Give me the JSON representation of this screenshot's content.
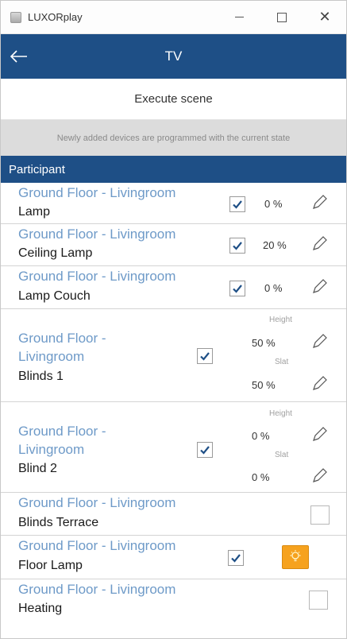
{
  "window": {
    "title": "LUXORplay",
    "minimize_icon": "minimize-icon",
    "maximize_icon": "maximize-icon",
    "close_icon": "close-icon",
    "close_glyph": "✕"
  },
  "header": {
    "title": "TV",
    "back_icon": "arrow-left-icon"
  },
  "execute_label": "Execute scene",
  "notice": "Newly added devices are programmed with the current state",
  "section_title": "Participant",
  "colors": {
    "accent": "#1e4f86",
    "location_text": "#6e9ac8",
    "bulb": "#f6a21e"
  },
  "rows": [
    {
      "location": "Ground Floor - Livingroom",
      "device": "Lamp",
      "checked": true,
      "value": "0 %"
    },
    {
      "location": "Ground Floor - Livingroom",
      "device": "Ceiling Lamp",
      "checked": true,
      "value": "20 %"
    },
    {
      "location": "Ground Floor - Livingroom",
      "device": "Lamp Couch",
      "checked": true,
      "value": "0 %"
    },
    {
      "location_line1": "Ground Floor -",
      "location_line2": "Livingroom",
      "device": "Blinds 1",
      "checked": true,
      "height_label": "Height",
      "height_value": "50 %",
      "slat_label": "Slat",
      "slat_value": "50 %"
    },
    {
      "location_line1": "Ground Floor -",
      "location_line2": "Livingroom",
      "device": "Blind 2",
      "checked": true,
      "height_label": "Height",
      "height_value": "0 %",
      "slat_label": "Slat",
      "slat_value": "0 %"
    },
    {
      "location": "Ground Floor - Livingroom",
      "device": "Blinds Terrace",
      "checked": false
    },
    {
      "location": "Ground Floor - Livingroom",
      "device": "Floor Lamp",
      "checked": true,
      "bulb_icon": "light-bulb-icon"
    },
    {
      "location": "Ground Floor - Livingroom",
      "device": "Heating",
      "checked": false
    }
  ]
}
